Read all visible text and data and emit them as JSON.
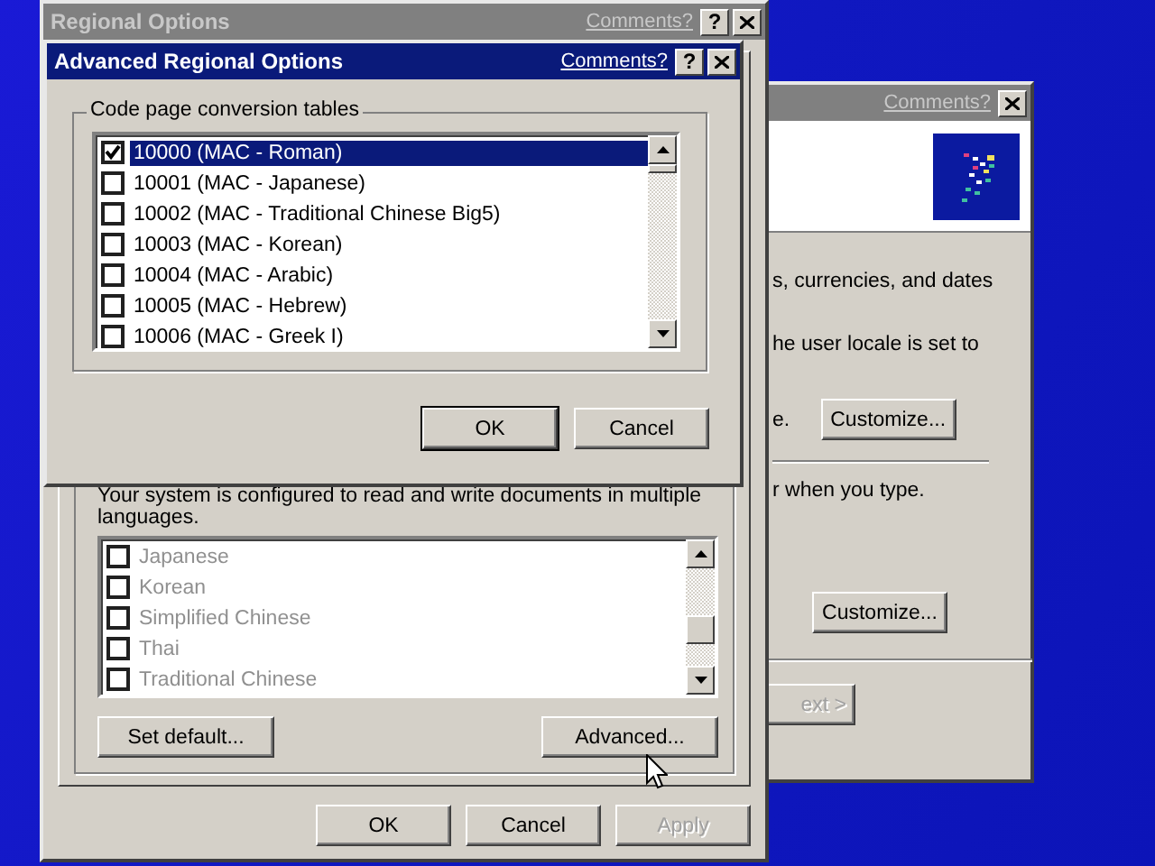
{
  "back_window": {
    "active": false,
    "comments_link": "Comments?",
    "text_1": "s, currencies, and dates",
    "text_2": "he user locale is set to",
    "text_3": "e.",
    "customize_buttons": [
      "Customize...",
      "Customize..."
    ],
    "text_4": "r when you type.",
    "next_button": {
      "label": "ext >",
      "disabled": true
    }
  },
  "regional_options": {
    "title": "Regional Options",
    "active": false,
    "comments_link": "Comments?",
    "help_button": "?",
    "info_text": "Your system is configured to read and write documents in multiple languages.",
    "languages": [
      {
        "label": "Japanese",
        "checked": false,
        "disabled": true
      },
      {
        "label": "Korean",
        "checked": false,
        "disabled": true
      },
      {
        "label": "Simplified Chinese",
        "checked": false,
        "disabled": true
      },
      {
        "label": "Thai",
        "checked": false,
        "disabled": true
      },
      {
        "label": "Traditional Chinese",
        "checked": false,
        "disabled": true
      }
    ],
    "set_default_button": "Set default...",
    "advanced_button": "Advanced...",
    "buttons": [
      {
        "label": "OK",
        "disabled": false
      },
      {
        "label": "Cancel",
        "disabled": false
      },
      {
        "label": "Apply",
        "disabled": true
      }
    ]
  },
  "advanced_dialog": {
    "title": "Advanced Regional Options",
    "active": true,
    "comments_link": "Comments?",
    "help_button": "?",
    "group_label": "Code page conversion tables",
    "code_pages": [
      {
        "label": "10000 (MAC - Roman)",
        "checked": true,
        "selected": true
      },
      {
        "label": "10001 (MAC - Japanese)",
        "checked": false,
        "selected": false
      },
      {
        "label": "10002 (MAC - Traditional Chinese Big5)",
        "checked": false,
        "selected": false
      },
      {
        "label": "10003 (MAC - Korean)",
        "checked": false,
        "selected": false
      },
      {
        "label": "10004 (MAC - Arabic)",
        "checked": false,
        "selected": false
      },
      {
        "label": "10005 (MAC - Hebrew)",
        "checked": false,
        "selected": false
      },
      {
        "label": "10006 (MAC - Greek I)",
        "checked": false,
        "selected": false
      }
    ],
    "buttons": [
      {
        "label": "OK",
        "default": true
      },
      {
        "label": "Cancel",
        "default": false
      }
    ]
  }
}
